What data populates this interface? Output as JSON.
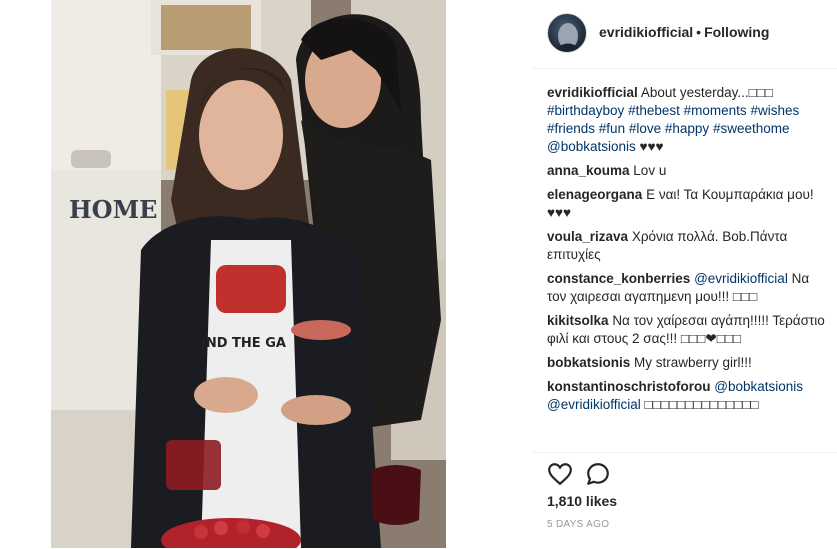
{
  "post": {
    "username": "evridikiofficial",
    "separator": "•",
    "follow_status": "Following"
  },
  "photo": {
    "sign_text": "HOME",
    "shirt_text": "IND THE GA"
  },
  "comments": [
    {
      "user": "evridikiofficial",
      "parts": [
        {
          "text": "About yesterday...□□□ ",
          "tag": false
        },
        {
          "text": "#birthdayboy",
          "tag": true
        },
        {
          "text": " ",
          "tag": false
        },
        {
          "text": "#thebest",
          "tag": true
        },
        {
          "text": " ",
          "tag": false
        },
        {
          "text": "#moments",
          "tag": true
        },
        {
          "text": " ",
          "tag": false
        },
        {
          "text": "#wishes",
          "tag": true
        },
        {
          "text": " ",
          "tag": false
        },
        {
          "text": "#friends",
          "tag": true
        },
        {
          "text": " ",
          "tag": false
        },
        {
          "text": "#fun",
          "tag": true
        },
        {
          "text": " ",
          "tag": false
        },
        {
          "text": "#love",
          "tag": true
        },
        {
          "text": " ",
          "tag": false
        },
        {
          "text": "#happy",
          "tag": true
        },
        {
          "text": " ",
          "tag": false
        },
        {
          "text": "#sweethome",
          "tag": true
        },
        {
          "text": " ",
          "tag": false
        },
        {
          "text": "@bobkatsionis",
          "tag": true
        },
        {
          "text": " ♥♥♥",
          "tag": false
        }
      ]
    },
    {
      "user": "anna_kouma",
      "parts": [
        {
          "text": "Lov u",
          "tag": false
        }
      ]
    },
    {
      "user": "elenageorgana",
      "parts": [
        {
          "text": "Ε ναι! Τα Κουμπαράκια μου! ♥♥♥",
          "tag": false
        }
      ]
    },
    {
      "user": "voula_rizava",
      "parts": [
        {
          "text": "Χρόνια πολλά. Bob.Πάντα επιτυχίες",
          "tag": false
        }
      ]
    },
    {
      "user": "constance_konberries",
      "parts": [
        {
          "text": "@evridikiofficial",
          "tag": true
        },
        {
          "text": " Να τον χαιρεσαι αγαπημενη μου!!! □□□",
          "tag": false
        }
      ]
    },
    {
      "user": "kikitsolka",
      "parts": [
        {
          "text": "Να τον χαίρεσαι αγάπη!!!!! Τεράστιο φιλί και στους 2 σας!!! □□□❤□□□",
          "tag": false
        }
      ]
    },
    {
      "user": "bobkatsionis",
      "parts": [
        {
          "text": "My strawberry girl!!!",
          "tag": false
        }
      ]
    },
    {
      "user": "konstantinoschristoforou",
      "parts": [
        {
          "text": "@bobkatsionis",
          "tag": true
        },
        {
          "text": " ",
          "tag": false
        },
        {
          "text": "@evridikiofficial",
          "tag": true
        },
        {
          "text": " □□□□□□□□□□□□□□",
          "tag": false
        }
      ]
    }
  ],
  "likes_text": "1,810 likes",
  "timestamp": "5 DAYS AGO",
  "icons": {
    "like": "heart-icon",
    "comment": "comment-bubble-icon"
  },
  "colors": {
    "tag": "#003569",
    "text": "#262626",
    "muted": "#999999"
  }
}
